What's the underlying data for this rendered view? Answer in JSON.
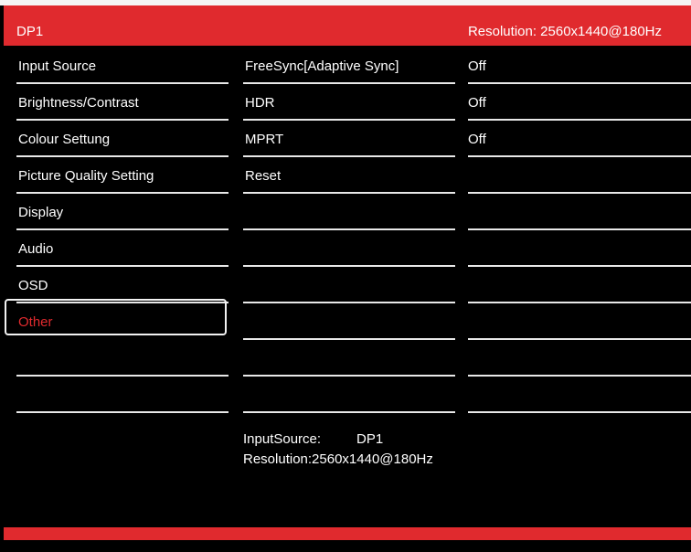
{
  "header": {
    "title": "DP1",
    "resolution": "Resolution: 2560x1440@180Hz"
  },
  "menu": {
    "items": [
      {
        "label": "Input Source"
      },
      {
        "label": "Brightness/Contrast"
      },
      {
        "label": "Colour Settung"
      },
      {
        "label": "Picture Quality Setting"
      },
      {
        "label": "Display"
      },
      {
        "label": "Audio"
      },
      {
        "label": "OSD"
      },
      {
        "label": "Other"
      },
      {
        "label": ""
      },
      {
        "label": ""
      }
    ],
    "selected": "Other"
  },
  "submenu": {
    "items": [
      {
        "label": "FreeSync[Adaptive Sync]",
        "value": "Off"
      },
      {
        "label": "HDR",
        "value": "Off"
      },
      {
        "label": "MPRT",
        "value": "Off"
      },
      {
        "label": "Reset",
        "value": ""
      },
      {
        "label": "",
        "value": ""
      },
      {
        "label": "",
        "value": ""
      },
      {
        "label": "",
        "value": ""
      },
      {
        "label": "",
        "value": ""
      },
      {
        "label": "",
        "value": ""
      },
      {
        "label": "",
        "value": ""
      }
    ]
  },
  "info": {
    "input_label": "InputSource:",
    "input_value": "DP1",
    "resolution": "Resolution:2560x1440@180Hz"
  },
  "colors": {
    "accent": "#e02a2e",
    "background": "#000000",
    "text": "#ffffff"
  }
}
